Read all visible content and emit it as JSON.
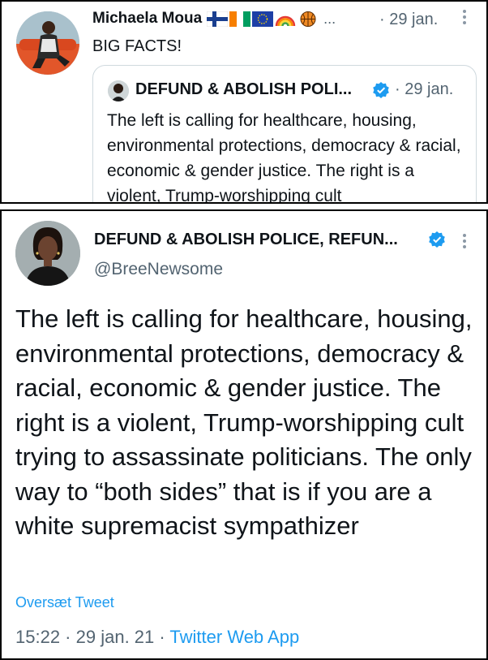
{
  "top_tweet": {
    "author_name": "Michaela Moua",
    "flags": [
      "finland-flag",
      "ivory-coast-flag",
      "eu-flag",
      "rainbow",
      "basketball"
    ],
    "ellipsis": "...",
    "date": "· 29 jan.",
    "text": "BIG FACTS!",
    "quote": {
      "author_name": "DEFUND & ABOLISH POLI...",
      "date": "· 29 jan.",
      "text": "The left is calling for healthcare, housing, environmental protections, democracy & racial, economic & gender justice. The right is a violent, Trump-worshipping cult"
    }
  },
  "main_tweet": {
    "author_name": "DEFUND & ABOLISH POLICE, REFUN...",
    "handle": "@BreeNewsome",
    "text": "The left is calling for healthcare, housing, environmental protections, democracy & racial, economic & gender justice. The right is a violent, Trump-worshipping cult trying to assassinate politicians. The only way to “both sides” that is if you are a white supremacist sympathizer",
    "translate_label": "Oversæt Tweet",
    "time": "15:22",
    "date": "29 jan. 21",
    "source": "Twitter Web App",
    "sep": " · "
  },
  "colors": {
    "link": "#1d9bf0",
    "secondary_text": "#536471",
    "verified": "#1d9bf0"
  }
}
